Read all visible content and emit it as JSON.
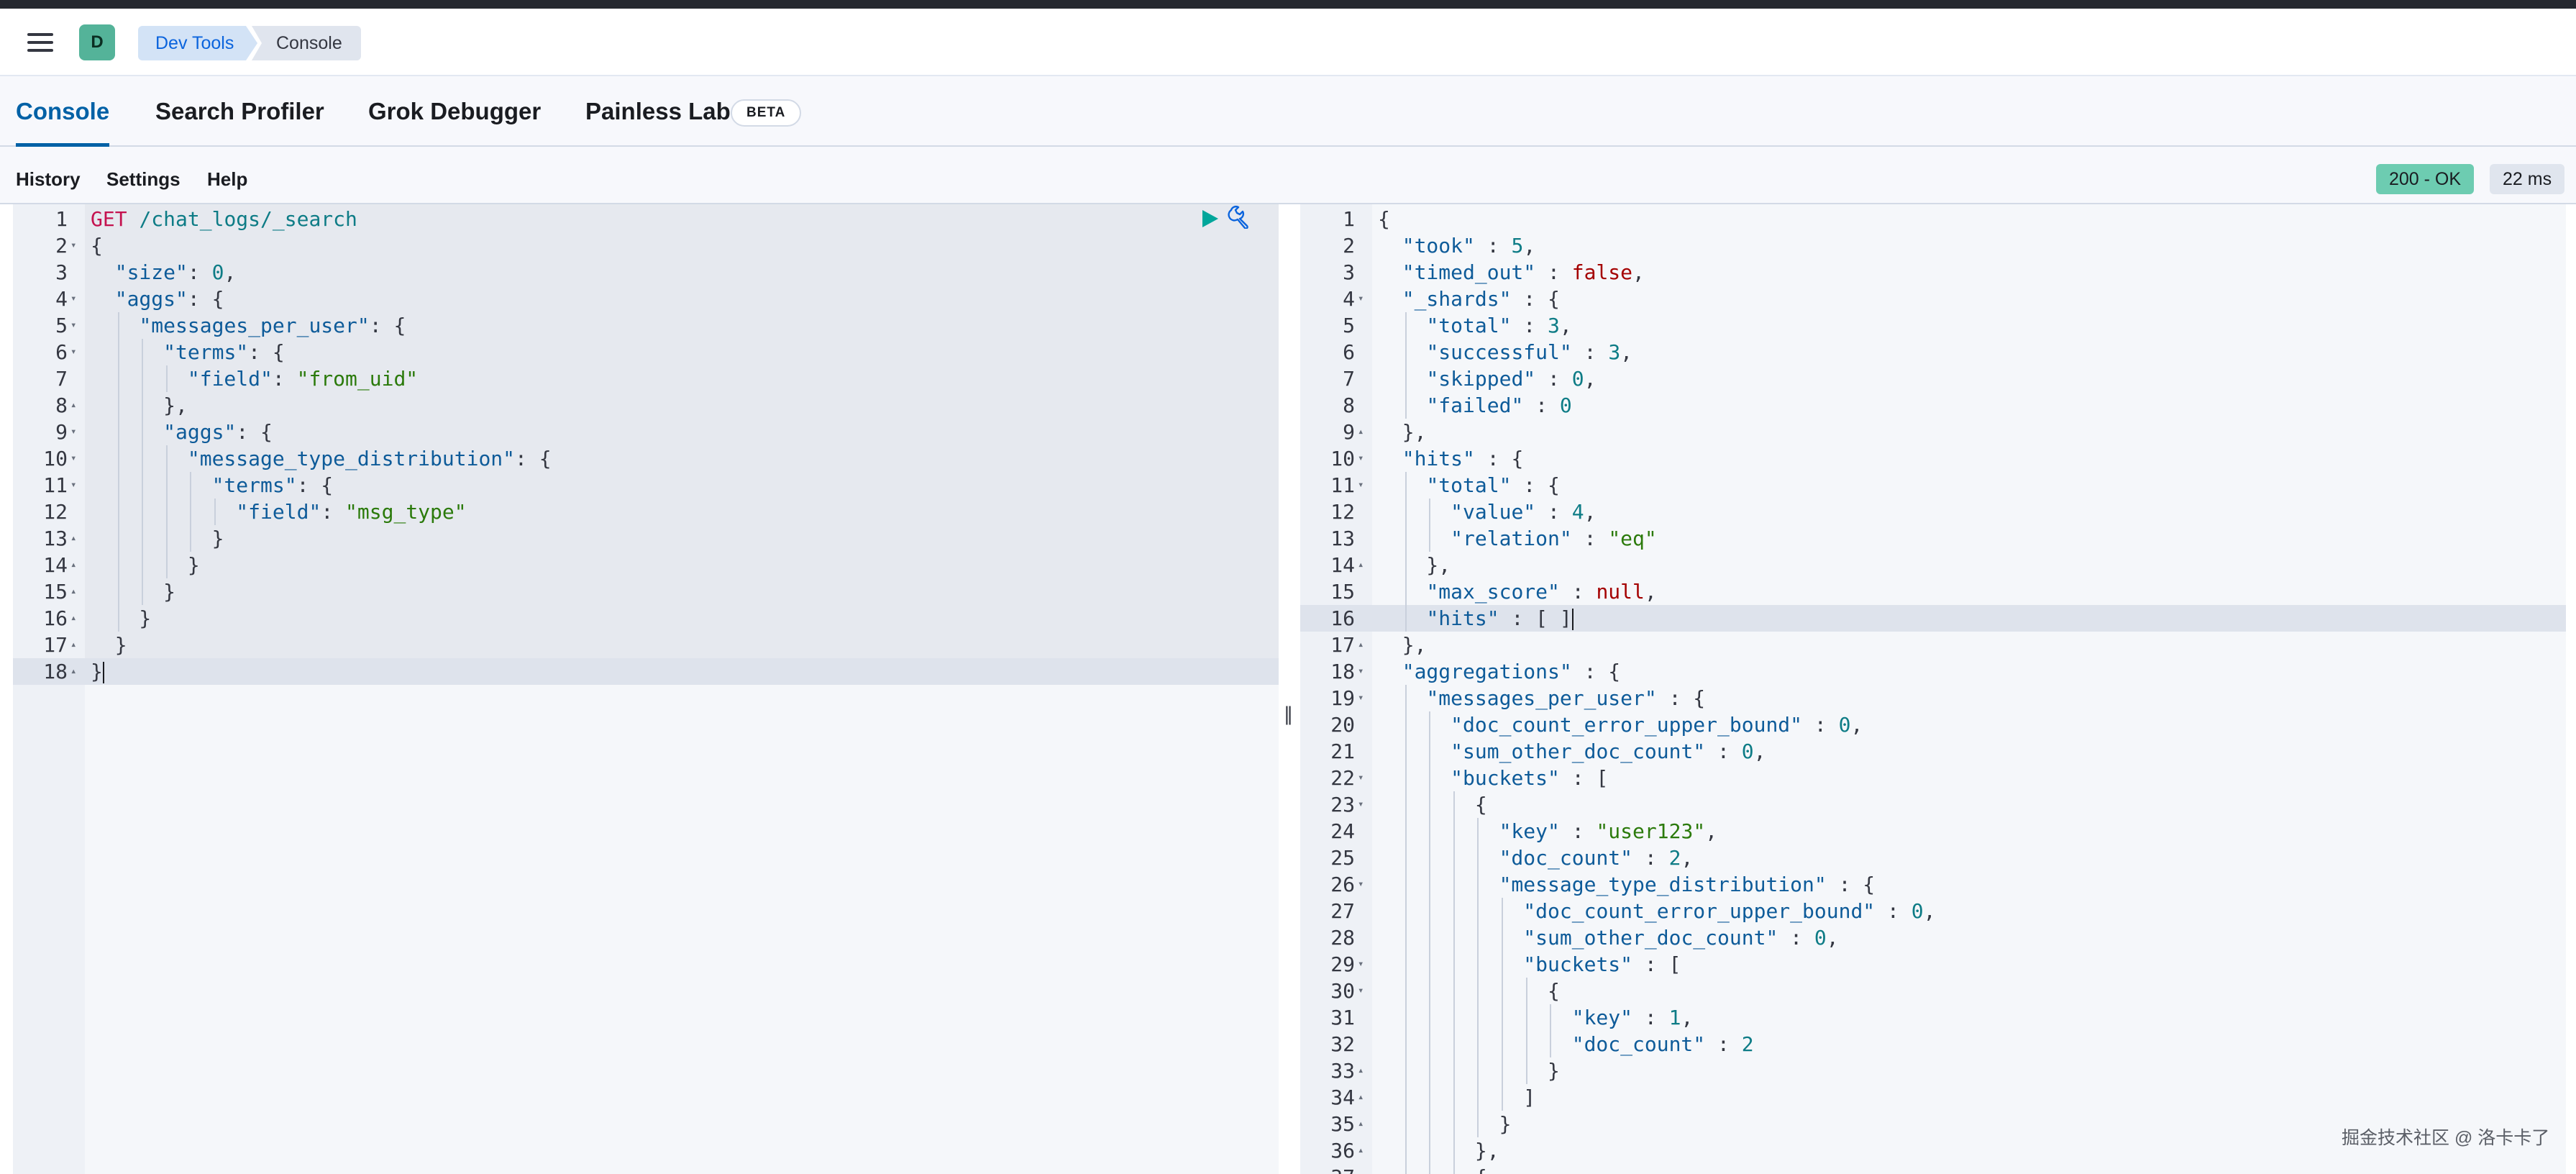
{
  "header": {
    "avatar_letter": "D",
    "breadcrumbs": [
      "Dev Tools",
      "Console"
    ]
  },
  "tabs": [
    {
      "label": "Console",
      "active": true
    },
    {
      "label": "Search Profiler",
      "active": false
    },
    {
      "label": "Grok Debugger",
      "active": false
    },
    {
      "label": "Painless Lab",
      "active": false
    }
  ],
  "beta_badge": "BETA",
  "toolbar": {
    "history": "History",
    "settings": "Settings",
    "help": "Help",
    "status": "200 - OK",
    "time": "22 ms"
  },
  "request": {
    "method": "GET",
    "path": "/chat_logs/_search",
    "lines": [
      "GET /chat_logs/_search",
      "{",
      "  \"size\": 0,",
      "  \"aggs\": {",
      "    \"messages_per_user\": {",
      "      \"terms\": {",
      "        \"field\": \"from_uid\"",
      "      },",
      "      \"aggs\": {",
      "        \"message_type_distribution\": {",
      "          \"terms\": {",
      "            \"field\": \"msg_type\"",
      "          }",
      "        }",
      "      }",
      "    }",
      "  }",
      "}"
    ]
  },
  "response": {
    "lines": [
      "{",
      "  \"took\" : 5,",
      "  \"timed_out\" : false,",
      "  \"_shards\" : {",
      "    \"total\" : 3,",
      "    \"successful\" : 3,",
      "    \"skipped\" : 0,",
      "    \"failed\" : 0",
      "  },",
      "  \"hits\" : {",
      "    \"total\" : {",
      "      \"value\" : 4,",
      "      \"relation\" : \"eq\"",
      "    },",
      "    \"max_score\" : null,",
      "    \"hits\" : [ ]",
      "  },",
      "  \"aggregations\" : {",
      "    \"messages_per_user\" : {",
      "      \"doc_count_error_upper_bound\" : 0,",
      "      \"sum_other_doc_count\" : 0,",
      "      \"buckets\" : [",
      "        {",
      "          \"key\" : \"user123\",",
      "          \"doc_count\" : 2,",
      "          \"message_type_distribution\" : {",
      "            \"doc_count_error_upper_bound\" : 0,",
      "            \"sum_other_doc_count\" : 0,",
      "            \"buckets\" : [",
      "              {",
      "                \"key\" : 1,",
      "                \"doc_count\" : 2",
      "              }",
      "            ]",
      "          }",
      "        },",
      "        {"
    ]
  },
  "watermark": "掘金技术社区 @ 洛卡卡了"
}
